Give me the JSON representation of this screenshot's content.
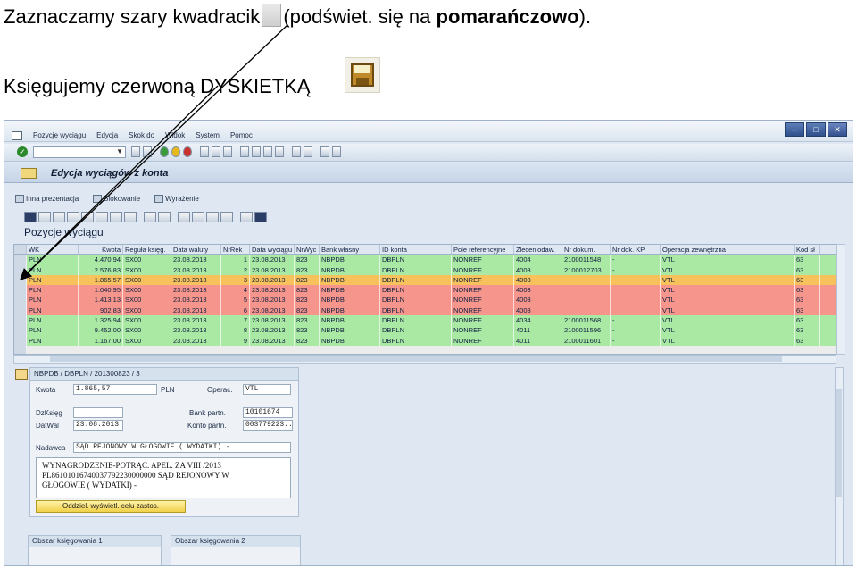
{
  "caption1": {
    "text1": "Zaznaczamy szary kwadracik",
    "text2": "(podświet. się na ",
    "bold": "pomarańczowo",
    "text3": ")."
  },
  "caption2": {
    "text": "Księgujemy czerwoną DYSKIETKĄ"
  },
  "sap": {
    "menu": [
      "Pozycje wyciągu",
      "Edycja",
      "Skok do",
      "Widok",
      "System",
      "Pomoc"
    ],
    "header_title": "Edycja wyciągów z konta",
    "toolbar2": [
      "Inna prezentacja",
      "Blokowanie",
      "Wyrażenie"
    ],
    "list_title": "Pozycje wyciągu",
    "table": {
      "columns": [
        "WK",
        "Kwota",
        "Reguła księg.",
        "Data waluty",
        "NrRek",
        "Data wyciągu",
        "NrWyc",
        "Bank własny",
        "ID konta",
        "Pole referencyjne",
        "Zleceniodaw.",
        "Nr dokum.",
        "Nr dok. KP",
        "Operacja zewnętrzna",
        "Kod sł"
      ],
      "rows": [
        {
          "status": "green",
          "cells": [
            "PLN",
            "4.470,94",
            "SX00",
            "23.08.2013",
            "1",
            "23.08.2013",
            "823",
            "NBPDB",
            "DBPLN",
            "NONREF",
            "4004",
            "2100011548",
            "-",
            "VTL",
            "63"
          ]
        },
        {
          "status": "green",
          "cells": [
            "PLN",
            "2.576,83",
            "SX00",
            "23.08.2013",
            "2",
            "23.08.2013",
            "823",
            "NBPDB",
            "DBPLN",
            "NONREF",
            "4003",
            "2100012703",
            "-",
            "VTL",
            "63"
          ]
        },
        {
          "status": "orange",
          "cells": [
            "PLN",
            "1.865,57",
            "SX00",
            "23.08.2013",
            "3",
            "23.08.2013",
            "823",
            "NBPDB",
            "DBPLN",
            "NONREF",
            "4003",
            "",
            "",
            "VTL",
            "63"
          ]
        },
        {
          "status": "red",
          "cells": [
            "PLN",
            "1.040,95",
            "SX00",
            "23.08.2013",
            "4",
            "23.08.2013",
            "823",
            "NBPDB",
            "DBPLN",
            "NONREF",
            "4003",
            "",
            "",
            "VTL",
            "63"
          ]
        },
        {
          "status": "red",
          "cells": [
            "PLN",
            "1.413,13",
            "SX00",
            "23.08.2013",
            "5",
            "23.08.2013",
            "823",
            "NBPDB",
            "DBPLN",
            "NONREF",
            "4003",
            "",
            "",
            "VTL",
            "63"
          ]
        },
        {
          "status": "red",
          "cells": [
            "PLN",
            "902,83",
            "SX00",
            "23.08.2013",
            "6",
            "23.08.2013",
            "823",
            "NBPDB",
            "DBPLN",
            "NONREF",
            "4003",
            "",
            "",
            "VTL",
            "63"
          ]
        },
        {
          "status": "green",
          "cells": [
            "PLN",
            "1.325,94",
            "SX00",
            "23.08.2013",
            "7",
            "23.08.2013",
            "823",
            "NBPDB",
            "DBPLN",
            "NONREF",
            "4034",
            "2100011568",
            "-",
            "VTL",
            "63"
          ]
        },
        {
          "status": "green",
          "cells": [
            "PLN",
            "9.452,00",
            "SX00",
            "23.08.2013",
            "8",
            "23.08.2013",
            "823",
            "NBPDB",
            "DBPLN",
            "NONREF",
            "4011",
            "2100011596",
            "-",
            "VTL",
            "63"
          ]
        },
        {
          "status": "green",
          "cells": [
            "PLN",
            "1.167,00",
            "SX00",
            "23.08.2013",
            "9",
            "23.08.2013",
            "823",
            "NBPDB",
            "DBPLN",
            "NONREF",
            "4011",
            "2100011601",
            "-",
            "VTL",
            "63"
          ]
        }
      ]
    },
    "detail": {
      "header": "NBPDB / DBPLN / 201300823 / 3",
      "kwota_label": "Kwota",
      "kwota_value": "1.865,57",
      "currency": "PLN",
      "operac_label": "Operac.",
      "operac_value": "VTL",
      "dzksieg_label": "DzKsięg",
      "dzksieg_value": "",
      "datwal_label": "DatWal",
      "datwal_value": "23.08.2013",
      "bank_label": "Bank partn.",
      "bank_value": "10101674",
      "konto_label": "Konto partn.",
      "konto_value": "003779223..",
      "nadawca_label": "Nadawca",
      "nadawca_value": "SĄD REJONOWY W GŁOGOWIE ( WYDATKI) -",
      "memo_lines": [
        "WYNAGRODZENIE-POTRĄC. APEL. ZA VIII /2013",
        "PL86101016740037792230000000 SĄD REJONOWY W",
        "GŁOGOWIE ( WYDATKI) -"
      ],
      "button": "Oddziel. wyświetl. celu zastos."
    },
    "areas": [
      "Obszar księgowania 1",
      "Obszar księgowania 2"
    ]
  },
  "colors": {
    "row_green": "#a9e9a4",
    "row_orange": "#f7c15c",
    "row_red": "#f5958c"
  }
}
